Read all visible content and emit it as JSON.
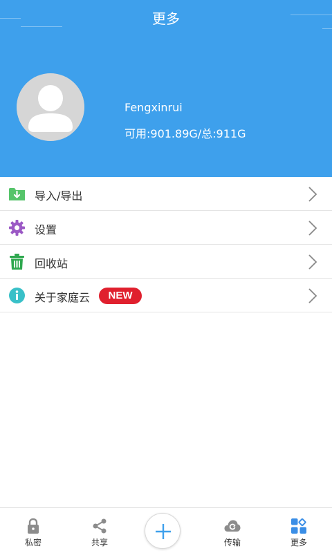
{
  "header": {
    "title": "更多",
    "background_color": "#3ea0ec"
  },
  "profile": {
    "avatar_icon": "user-avatar-icon",
    "username": "Fengxinrui",
    "storage": "可用:901.89G/总:911G"
  },
  "menu": {
    "items": [
      {
        "label": "导入/导出",
        "icon": "folder-download-icon",
        "icon_color": "#56c46a"
      },
      {
        "label": "设置",
        "icon": "gear-icon",
        "icon_color": "#9b59c5"
      },
      {
        "label": "回收站",
        "icon": "trash-icon",
        "icon_color": "#2fa84f"
      },
      {
        "label": "关于家庭云",
        "icon": "info-icon",
        "icon_color": "#39c0c8",
        "badge": "NEW",
        "badge_color": "#e0202e"
      }
    ]
  },
  "tabbar": {
    "tabs": [
      {
        "label": "私密",
        "icon": "lock-icon"
      },
      {
        "label": "共享",
        "icon": "share-icon"
      },
      {
        "label": "",
        "icon": "plus-icon"
      },
      {
        "label": "传输",
        "icon": "cloud-sync-icon"
      },
      {
        "label": "更多",
        "icon": "grid-more-icon",
        "active_color": "#3a8ee6"
      }
    ]
  }
}
